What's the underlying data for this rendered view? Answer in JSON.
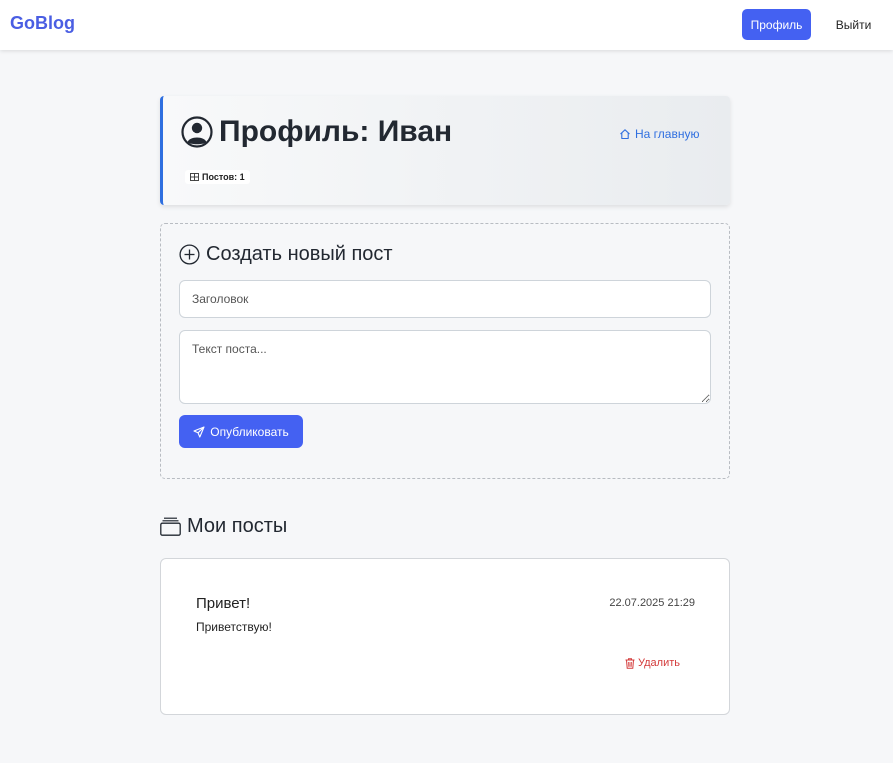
{
  "navbar": {
    "brand": "GoBlog",
    "profile_label": "Профиль",
    "logout_label": "Выйти"
  },
  "profile": {
    "title": "Профиль: Иван",
    "home_link": "На главную",
    "posts_count_label": "Постов: 1"
  },
  "create_post": {
    "heading": "Создать новый пост",
    "title_placeholder": "Заголовок",
    "body_placeholder": "Текст поста...",
    "publish_label": "Опубликовать"
  },
  "my_posts": {
    "heading": "Мои посты",
    "items": [
      {
        "title": "Привет!",
        "date": "22.07.2025 21:29",
        "body": "Приветствую!",
        "delete_label": "Удалить"
      }
    ]
  },
  "colors": {
    "primary": "#4461f2",
    "brand": "#4a5ee3",
    "link": "#2f6fe0",
    "danger": "#d43b3b",
    "background": "#f6f7f9"
  },
  "icons": {
    "profile_title": "person-circle-icon",
    "home": "house-icon",
    "posts_badge": "grid-icon",
    "create": "plus-circle-icon",
    "publish": "send-icon",
    "my_posts": "collection-icon",
    "delete": "trash-icon"
  }
}
